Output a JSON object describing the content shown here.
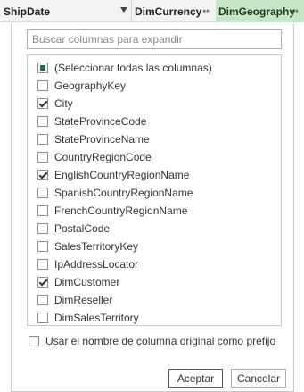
{
  "columns": {
    "ship_date": "ShipDate",
    "dim_currency": "DimCurrency",
    "dim_geography": "DimGeography",
    "expand_icon": "expand-columns-icon"
  },
  "search": {
    "placeholder": "Buscar columnas para expandir"
  },
  "items": [
    {
      "label": "(Seleccionar todas las columnas)",
      "state": "partial"
    },
    {
      "label": "GeographyKey",
      "state": "unchecked"
    },
    {
      "label": "City",
      "state": "checked"
    },
    {
      "label": "StateProvinceCode",
      "state": "unchecked"
    },
    {
      "label": "StateProvinceName",
      "state": "unchecked"
    },
    {
      "label": "CountryRegionCode",
      "state": "unchecked"
    },
    {
      "label": "EnglishCountryRegionName",
      "state": "checked"
    },
    {
      "label": "SpanishCountryRegionName",
      "state": "unchecked"
    },
    {
      "label": "FrenchCountryRegionName",
      "state": "unchecked"
    },
    {
      "label": "PostalCode",
      "state": "unchecked"
    },
    {
      "label": "SalesTerritoryKey",
      "state": "unchecked"
    },
    {
      "label": "IpAddressLocator",
      "state": "unchecked"
    },
    {
      "label": "DimCustomer",
      "state": "checked"
    },
    {
      "label": "DimReseller",
      "state": "unchecked"
    },
    {
      "label": "DimSalesTerritory",
      "state": "unchecked"
    }
  ],
  "prefix": {
    "label": "Usar el nombre de columna original como prefijo",
    "checked": false
  },
  "buttons": {
    "ok": "Aceptar",
    "cancel": "Cancelar"
  },
  "colors": {
    "accent": "#217346",
    "active_header": "#c6e7c6"
  }
}
